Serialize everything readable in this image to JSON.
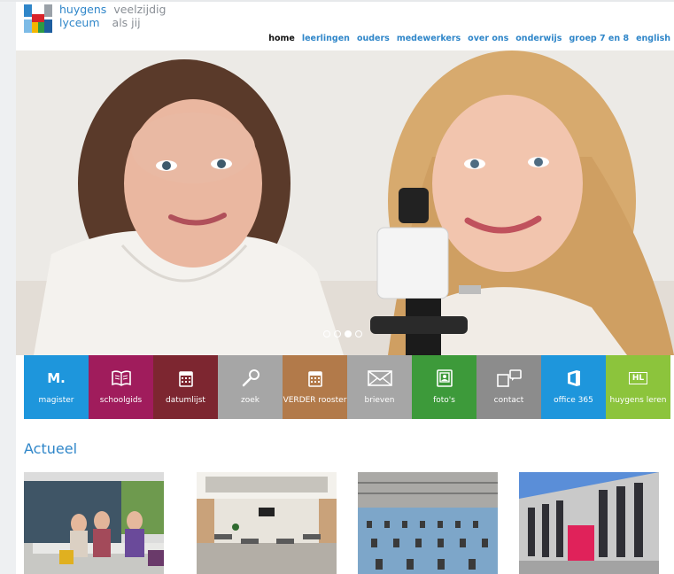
{
  "brand": {
    "name_line1": "huygens",
    "name_line2": "lyceum",
    "tagline_line1": "veelzijdig",
    "tagline_line2": "als jij"
  },
  "nav": [
    "home",
    "leerlingen",
    "ouders",
    "medewerkers",
    "over ons",
    "onderwijs",
    "groep 7 en 8",
    "english"
  ],
  "nav_active": "home",
  "hero": {
    "slide_count": 4,
    "active_slide": 3
  },
  "tiles": [
    {
      "label": "magister",
      "color": "#1e96dc",
      "icon": "magister-icon",
      "icon_text": "M."
    },
    {
      "label": "schoolgids",
      "color": "#a01c5c",
      "icon": "book-icon"
    },
    {
      "label": "datumlijst",
      "color": "#7d2630",
      "icon": "calendar-icon"
    },
    {
      "label": "zoek",
      "color": "#a6a6a6",
      "icon": "search-icon"
    },
    {
      "label": "VERDER rooster",
      "color": "#b27a4a",
      "icon": "schedule-icon"
    },
    {
      "label": "brieven",
      "color": "#a6a6a6",
      "icon": "envelope-icon"
    },
    {
      "label": "foto's",
      "color": "#3d9a3a",
      "icon": "photo-icon"
    },
    {
      "label": "contact",
      "color": "#8c8c8c",
      "icon": "contact-icon"
    },
    {
      "label": "office 365",
      "color": "#1e96dc",
      "icon": "office-icon"
    },
    {
      "label": "huygens leren",
      "color": "#8cc43c",
      "icon": "hl-icon",
      "icon_text": "HL"
    }
  ],
  "section_title": "Actueel",
  "news": [
    {
      "image": "students-outdoor-photo"
    },
    {
      "image": "school-hall-photo"
    },
    {
      "image": "exam-hall-photo"
    },
    {
      "image": "school-building-photo"
    }
  ]
}
